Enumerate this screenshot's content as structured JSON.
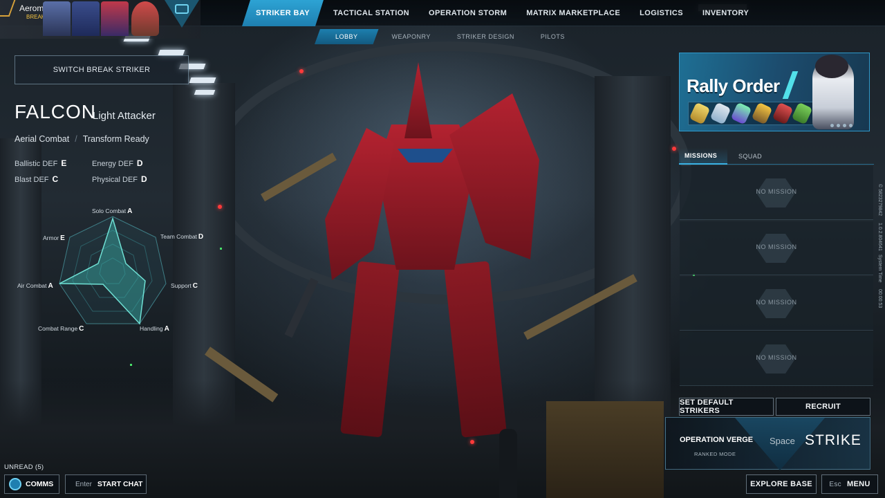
{
  "player": {
    "name": "Aeromesi",
    "tag": "BREAKer"
  },
  "nav": {
    "items": [
      {
        "label": "STRIKER BAY",
        "active": true
      },
      {
        "label": "TACTICAL STATION",
        "active": false
      },
      {
        "label": "OPERATION STORM",
        "active": false
      },
      {
        "label": "MATRIX MARKETPLACE",
        "active": false
      },
      {
        "label": "LOGISTICS",
        "active": false
      },
      {
        "label": "INVENTORY",
        "active": false
      }
    ]
  },
  "subnav": {
    "items": [
      {
        "label": "LOBBY",
        "active": true
      },
      {
        "label": "WEAPONRY",
        "active": false
      },
      {
        "label": "STRIKER DESIGN",
        "active": false
      },
      {
        "label": "PILOTS",
        "active": false
      }
    ]
  },
  "striker": {
    "switch_label": "SWITCH BREAK STRIKER",
    "name": "FALCON",
    "class": "Light Attacker",
    "traits": [
      "Aerial Combat",
      "Transform Ready"
    ],
    "trait_separator": "/",
    "defense": [
      {
        "label": "Ballistic DEF",
        "grade": "E"
      },
      {
        "label": "Energy DEF",
        "grade": "D"
      },
      {
        "label": "Blast DEF",
        "grade": "C"
      },
      {
        "label": "Physical DEF",
        "grade": "D"
      }
    ],
    "radar": [
      {
        "label": "Solo Combat",
        "grade": "A"
      },
      {
        "label": "Team Combat",
        "grade": "D"
      },
      {
        "label": "Support",
        "grade": "C"
      },
      {
        "label": "Handling",
        "grade": "A"
      },
      {
        "label": "Combat Range",
        "grade": "C"
      },
      {
        "label": "Air Combat",
        "grade": "A"
      },
      {
        "label": "Armor",
        "grade": "E"
      }
    ]
  },
  "rally": {
    "title": "Rally Order"
  },
  "panel": {
    "tabs": [
      {
        "label": "MISSIONS",
        "active": true
      },
      {
        "label": "SQUAD",
        "active": false
      }
    ],
    "missions": [
      "NO MISSION",
      "NO MISSION",
      "NO MISSION",
      "NO MISSION"
    ],
    "side_info": [
      "© 5823279842",
      "1.0.2.804641",
      "System Time",
      "00:00:53"
    ]
  },
  "actions": {
    "set_default": "SET DEFAULT STRIKERS",
    "recruit": "RECRUIT",
    "operation_name": "OPERATION VERGE",
    "operation_mode": "RANKED MODE",
    "strike_key": "Space",
    "strike_label": "STRIKE"
  },
  "bottom": {
    "unread": "UNREAD (5)",
    "comms": "COMMS",
    "chat_key": "Enter",
    "chat_label": "START CHAT",
    "explore_label": "EXPLORE BASE",
    "menu_key": "Esc",
    "menu_label": "MENU"
  },
  "colors": {
    "accent": "#2da3d4",
    "radar_fill": "#3ab0a8",
    "brand_gold": "#f5c542"
  }
}
